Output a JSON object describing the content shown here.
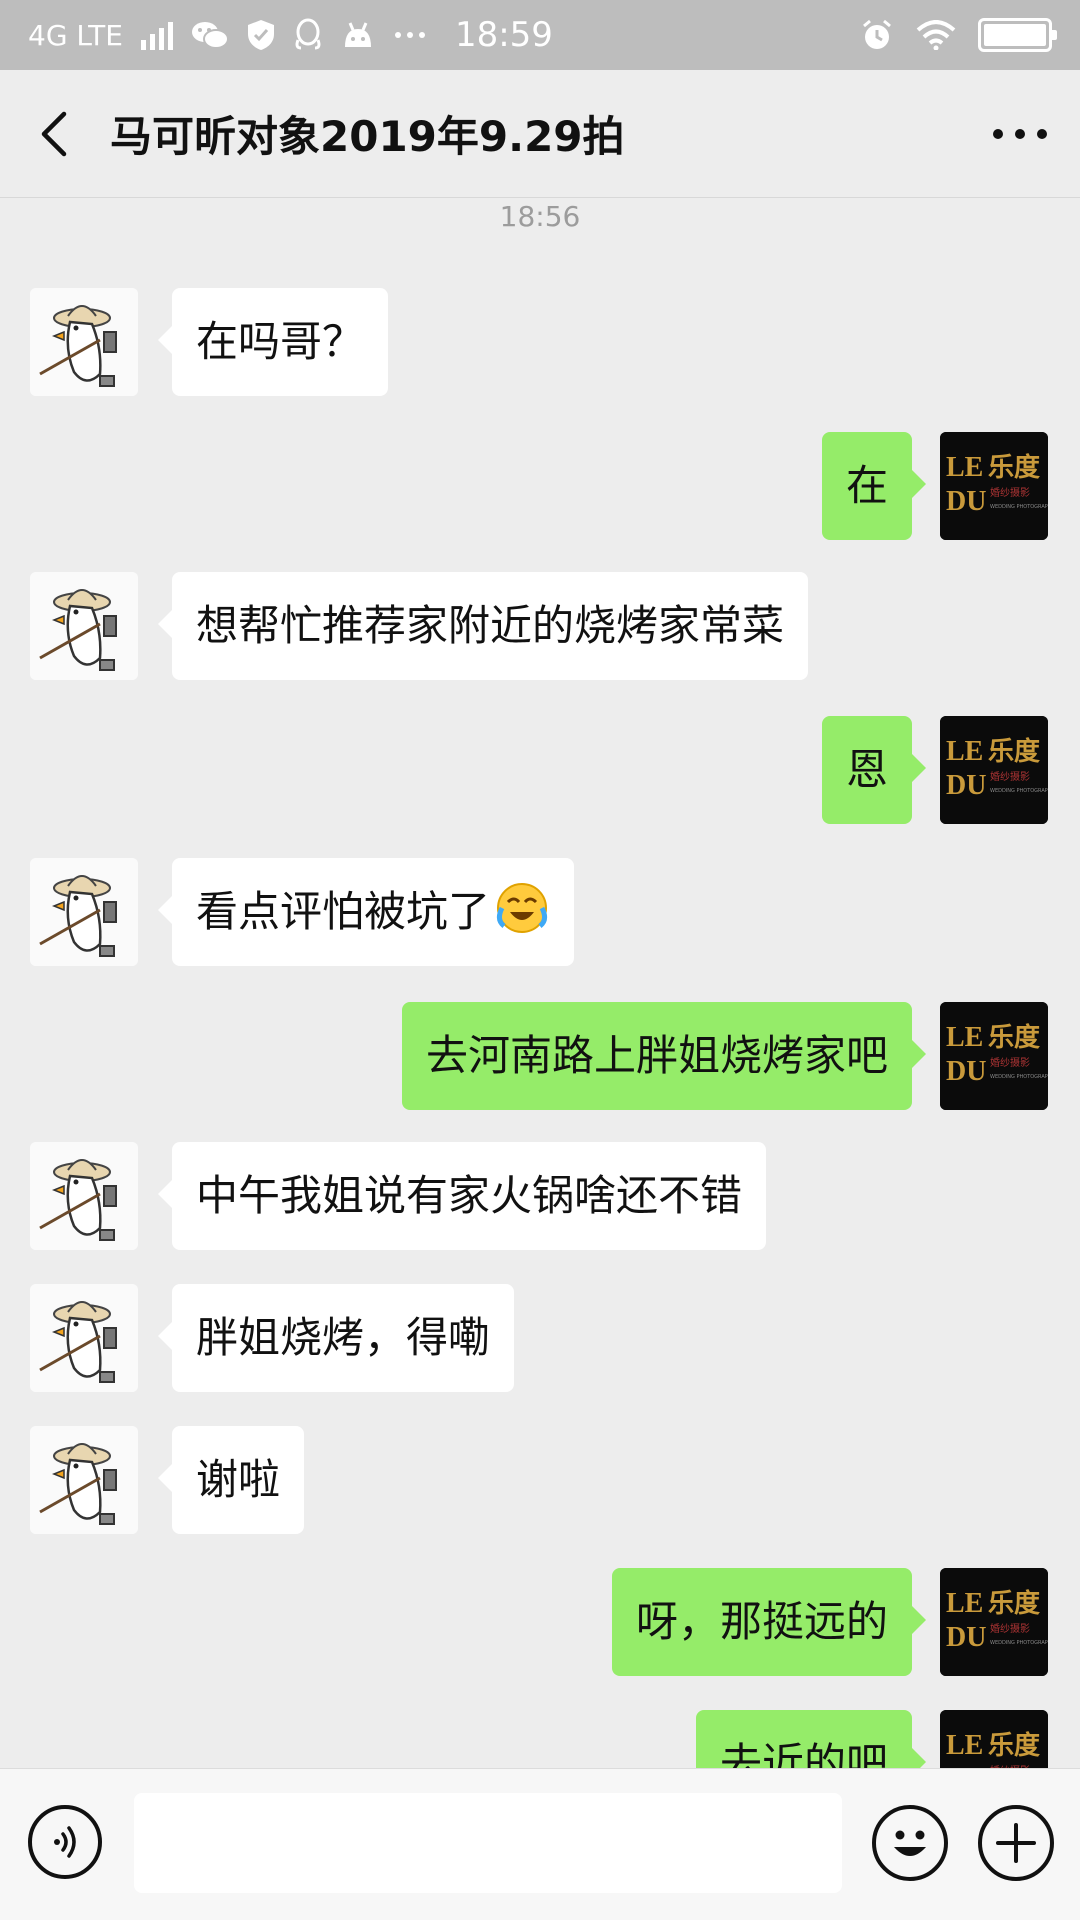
{
  "status_bar": {
    "network": "4G LTE",
    "time": "18:59",
    "icons": [
      "signal-bars-icon",
      "wechat-icon",
      "shield-icon",
      "qq-icon",
      "android-icon",
      "more-dots-icon",
      "alarm-icon",
      "wifi-icon",
      "battery-icon"
    ],
    "bg_color": "#bdbdbd"
  },
  "header": {
    "title": "马可昕对象2019年9.29拍",
    "back_icon": "chevron-left-icon",
    "more_icon": "more-horizontal-icon"
  },
  "chat": {
    "timestamp": "18:56",
    "left_bubble_color": "#ffffff",
    "right_bubble_color": "#95ec69",
    "contact_avatar": "goose-avatar",
    "self_avatar": {
      "line1_latin": "LE",
      "line1_cjk": "乐度",
      "line2_latin": "DU",
      "sub": "婚纱摄影",
      "tiny": "WEDDING PHOTOGRAPHY"
    },
    "messages": [
      {
        "side": "left",
        "text": "在吗哥？"
      },
      {
        "side": "right",
        "text": "在"
      },
      {
        "side": "left",
        "text": "想帮忙推荐家附近的烧烤家常菜"
      },
      {
        "side": "right",
        "text": "恩"
      },
      {
        "side": "left",
        "text": "看点评怕被坑了",
        "emoji": "crying-laughing-emoji-icon"
      },
      {
        "side": "right",
        "text": "去河南路上胖姐烧烤家吧"
      },
      {
        "side": "left",
        "text": "中午我姐说有家火锅啥还不错"
      },
      {
        "side": "left",
        "text": "胖姐烧烤，得嘞"
      },
      {
        "side": "left",
        "text": "谢啦"
      },
      {
        "side": "right",
        "text": "呀，那挺远的"
      },
      {
        "side": "right",
        "text": "去近的吧"
      }
    ]
  },
  "input_bar": {
    "voice_icon": "voice-icon",
    "emoji_icon": "emoji-icon",
    "plus_icon": "plus-icon",
    "text_value": ""
  }
}
